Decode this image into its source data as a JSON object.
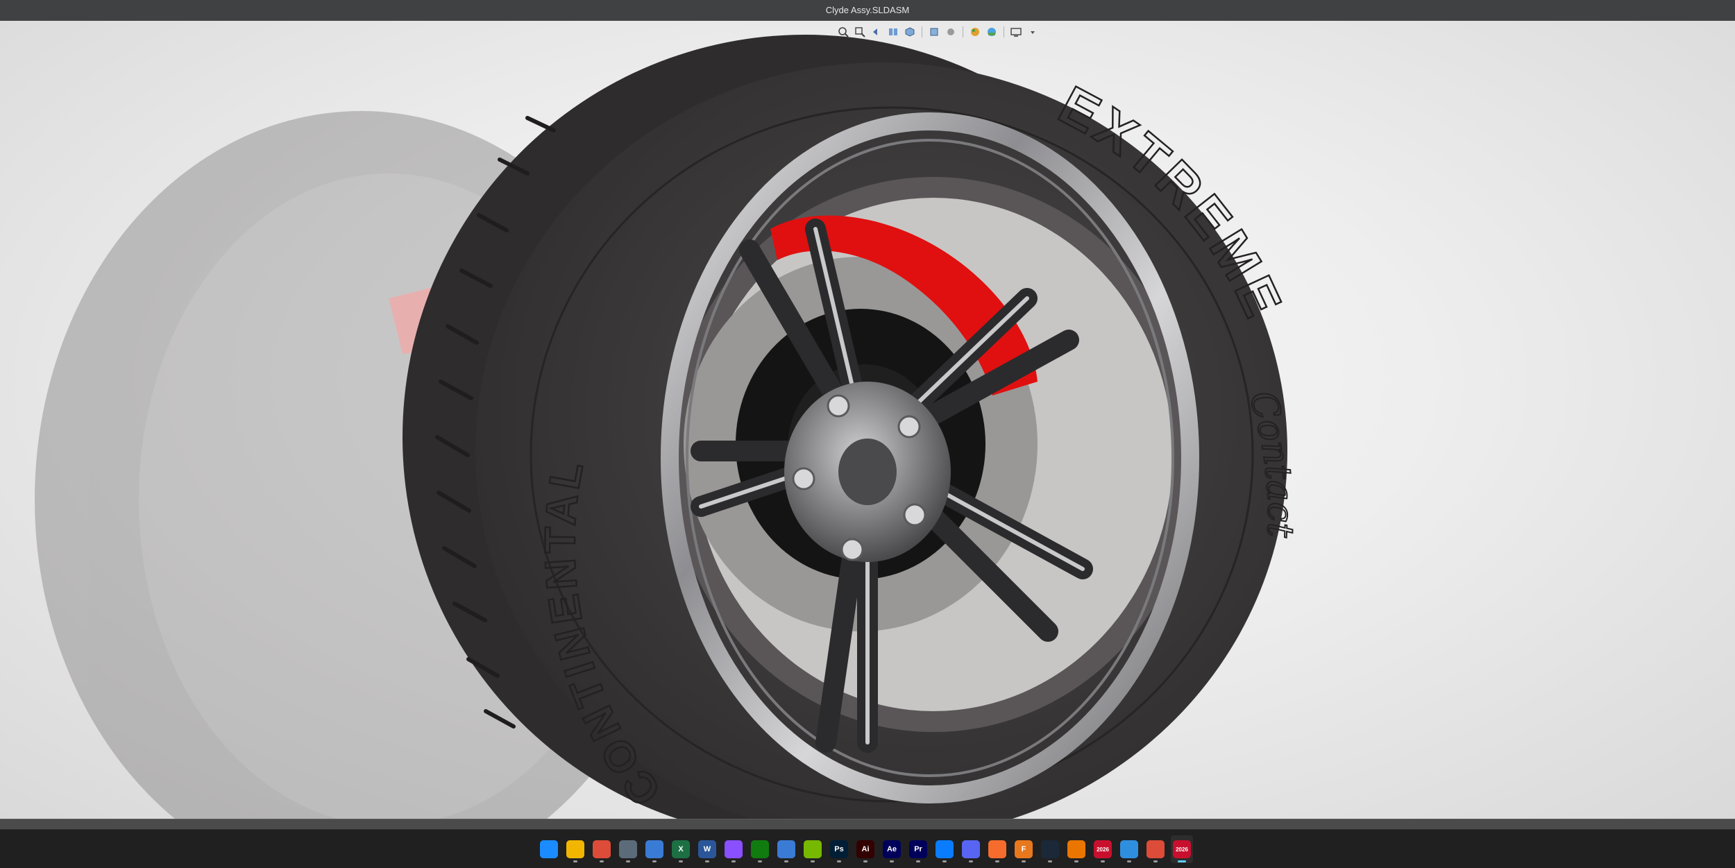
{
  "window": {
    "title": "Clyde Assy.SLDASM"
  },
  "viewport": {
    "tire_brand": "CONTINENTAL",
    "tire_model": "EXTREME",
    "tire_submodel": "Contact",
    "caliper_color": "#e01010",
    "tire_color": "#3a3838",
    "rim_color": "#b9b9bb",
    "hud_icons": [
      "zoom-to-fit-icon",
      "zoom-area-icon",
      "previous-view-icon",
      "section-view-icon",
      "view-orientation-icon",
      "display-style-icon",
      "hide-show-icon",
      "edit-appearance-icon",
      "apply-scene-icon",
      "view-settings-icon",
      "display-settings-icon"
    ]
  },
  "taskbar": {
    "apps": [
      {
        "name": "start-icon",
        "label": "",
        "color": "#1a8cff"
      },
      {
        "name": "file-explorer-icon",
        "label": "",
        "color": "#f2b600"
      },
      {
        "name": "chrome-icon",
        "label": "",
        "color": "#dd4b39"
      },
      {
        "name": "calculator-icon",
        "label": "",
        "color": "#5b6b7a"
      },
      {
        "name": "store-icon",
        "label": "",
        "color": "#3a7bd5"
      },
      {
        "name": "excel-icon",
        "label": "X",
        "color": "#1d7044"
      },
      {
        "name": "word-icon",
        "label": "W",
        "color": "#2b579a"
      },
      {
        "name": "camera-app-icon",
        "label": "",
        "color": "#8a4fff"
      },
      {
        "name": "xbox-icon",
        "label": "",
        "color": "#107c10"
      },
      {
        "name": "phone-link-icon",
        "label": "",
        "color": "#3a7bd5"
      },
      {
        "name": "nvidia-icon",
        "label": "",
        "color": "#76b900"
      },
      {
        "name": "photoshop-icon",
        "label": "Ps",
        "color": "#001e36"
      },
      {
        "name": "illustrator-icon",
        "label": "Ai",
        "color": "#330000"
      },
      {
        "name": "after-effects-icon",
        "label": "Ae",
        "color": "#00005b"
      },
      {
        "name": "premiere-icon",
        "label": "Pr",
        "color": "#00005b"
      },
      {
        "name": "messenger-icon",
        "label": "",
        "color": "#0a7cff"
      },
      {
        "name": "discord-icon",
        "label": "",
        "color": "#5865f2"
      },
      {
        "name": "origin-icon",
        "label": "",
        "color": "#f56c2d"
      },
      {
        "name": "fusion-icon",
        "label": "F",
        "color": "#e8781e"
      },
      {
        "name": "steam-icon",
        "label": "",
        "color": "#1b2838"
      },
      {
        "name": "blender-icon",
        "label": "",
        "color": "#ea7600"
      },
      {
        "name": "solidworks-2026-icon",
        "label": "2026",
        "color": "#c8102e"
      },
      {
        "name": "3d-viewer-icon",
        "label": "",
        "color": "#2f8fdf"
      },
      {
        "name": "chrome-alt-icon",
        "label": "",
        "color": "#dd4b39"
      },
      {
        "name": "solidworks-2026-active-icon",
        "label": "2026",
        "color": "#c8102e",
        "active": true
      }
    ]
  }
}
